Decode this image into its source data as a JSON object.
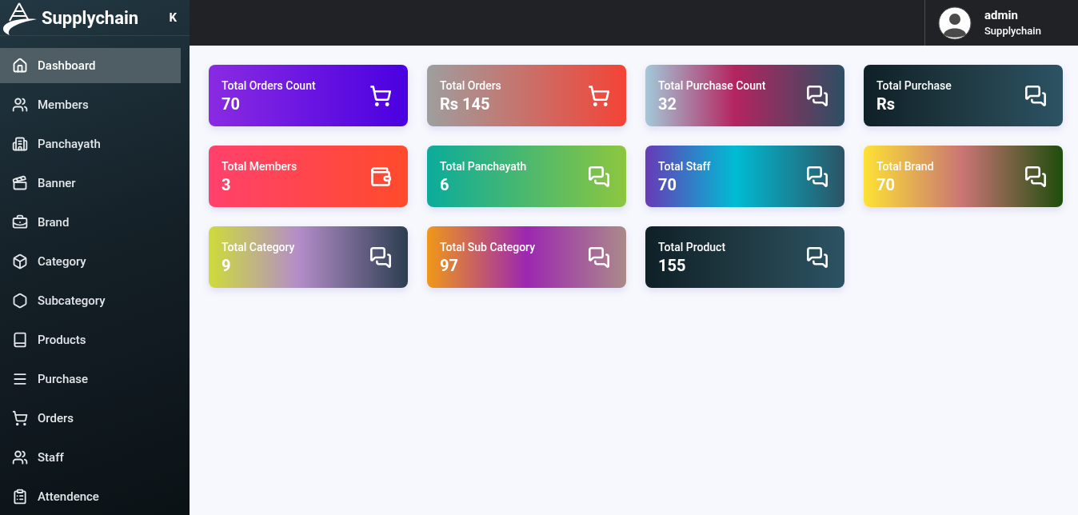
{
  "brand": {
    "name": "Supplychain",
    "collapse_icon": "K"
  },
  "sidebar": {
    "items": [
      {
        "label": "Dashboard",
        "kind": "home",
        "selected": true
      },
      {
        "label": "Members",
        "kind": "users",
        "selected": false
      },
      {
        "label": "Panchayath",
        "kind": "building",
        "selected": false
      },
      {
        "label": "Banner",
        "kind": "clapper",
        "selected": false
      },
      {
        "label": "Brand",
        "kind": "toolbox",
        "selected": false
      },
      {
        "label": "Category",
        "kind": "box",
        "selected": false
      },
      {
        "label": "Subcategory",
        "kind": "hexagon",
        "selected": false
      },
      {
        "label": "Products",
        "kind": "book",
        "selected": false
      },
      {
        "label": "Purchase",
        "kind": "lines",
        "selected": false
      },
      {
        "label": "Orders",
        "kind": "cart",
        "selected": false
      },
      {
        "label": "Staff",
        "kind": "users",
        "selected": false
      },
      {
        "label": "Attendence",
        "kind": "clipboard",
        "selected": false
      }
    ]
  },
  "user": {
    "name": "admin",
    "org": "Supplychain"
  },
  "cards": [
    {
      "title": "Total Orders Count",
      "value": "70",
      "kind": "cart"
    },
    {
      "title": "Total Orders",
      "value": "Rs 145",
      "kind": "cart"
    },
    {
      "title": "Total Purchase Count",
      "value": "32",
      "kind": "chat"
    },
    {
      "title": "Total Purchase",
      "value": "Rs",
      "kind": "chat"
    },
    {
      "title": "Total Members",
      "value": "3",
      "kind": "wallet"
    },
    {
      "title": "Total Panchayath",
      "value": "6",
      "kind": "chat"
    },
    {
      "title": "Total Staff",
      "value": "70",
      "kind": "chat"
    },
    {
      "title": "Total Brand",
      "value": "70",
      "kind": "chat"
    },
    {
      "title": "Total Category",
      "value": "9",
      "kind": "chat"
    },
    {
      "title": "Total Sub Category",
      "value": "97",
      "kind": "chat"
    },
    {
      "title": "Total Product",
      "value": "155",
      "kind": "chat"
    }
  ]
}
